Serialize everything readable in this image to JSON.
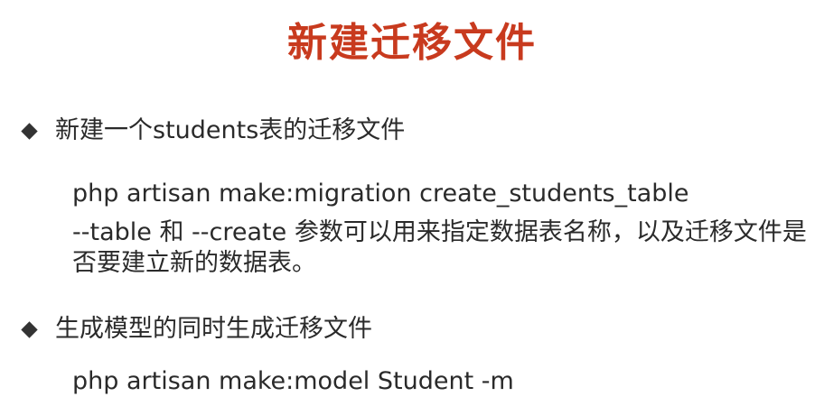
{
  "slide": {
    "title": "新建迁移文件"
  },
  "bullets": [
    {
      "text": "新建一个students表的迁移文件",
      "command": "php artisan make:migration create_students_table",
      "param_1": "--table",
      "connector": " 和  ",
      "param_2": "--create",
      "description": " 参数可以用来指定数据表名称，以及迁移文件是否要建立新的数据表。"
    },
    {
      "text": "生成模型的同时生成迁移文件",
      "command": "php artisan make:model Student -m"
    }
  ]
}
